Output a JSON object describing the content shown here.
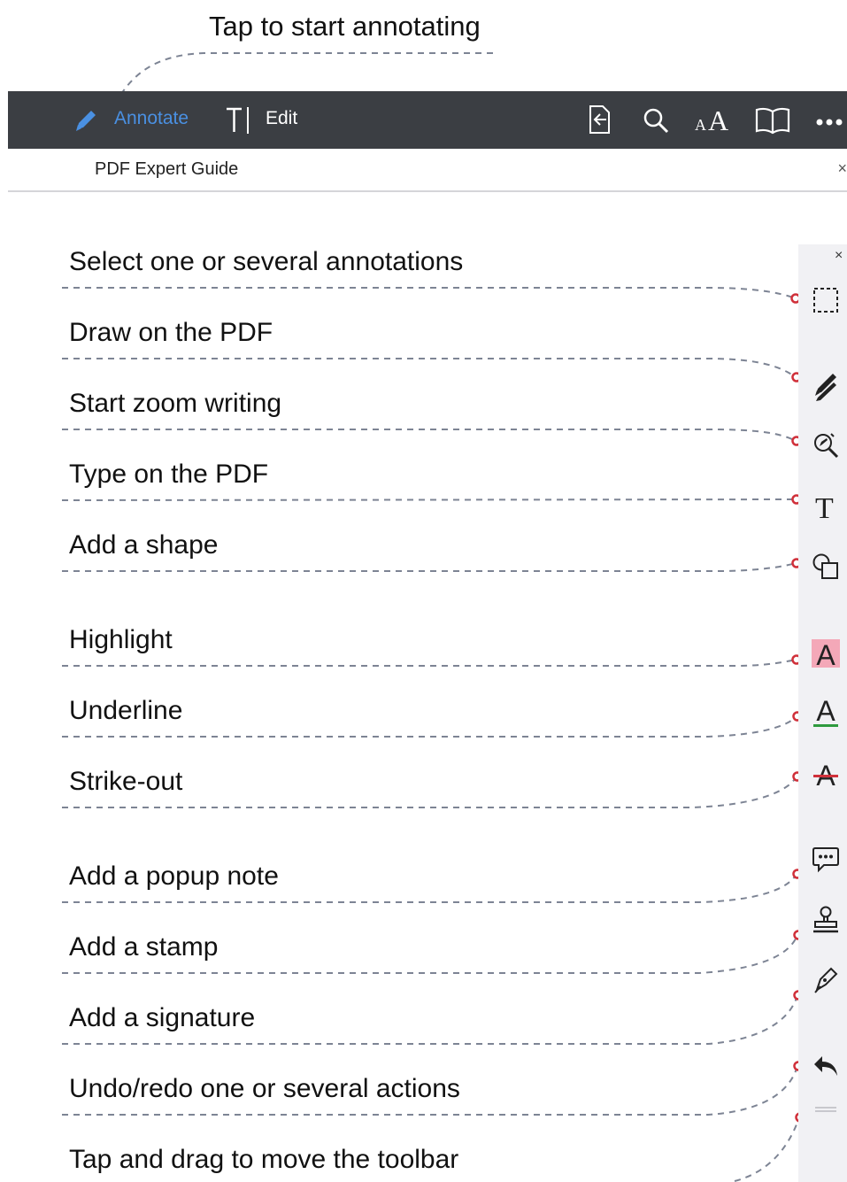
{
  "top_hint": "Tap to start annotating",
  "toolbar": {
    "annotate_label": "Annotate",
    "edit_label": "Edit",
    "icons": [
      "pencil-icon",
      "text-cursor-icon",
      "export-icon",
      "search-icon",
      "font-size-icon",
      "book-icon",
      "more-icon"
    ]
  },
  "document": {
    "title": "PDF Expert Guide",
    "close_glyph": "×"
  },
  "annotation_toolbar": {
    "close_glyph": "×",
    "items": [
      {
        "label": "Select one or several annotations",
        "icon": "selection-icon"
      },
      {
        "label": "Draw on the PDF",
        "icon": "pen-icon"
      },
      {
        "label": "Start zoom writing",
        "icon": "zoom-writing-icon"
      },
      {
        "label": "Type on the PDF",
        "icon": "text-icon"
      },
      {
        "label": "Add a shape",
        "icon": "shape-icon"
      },
      {
        "label": "Highlight",
        "icon": "highlight-icon"
      },
      {
        "label": "Underline",
        "icon": "underline-icon"
      },
      {
        "label": "Strike-out",
        "icon": "strikeout-icon"
      },
      {
        "label": "Add a popup note",
        "icon": "popup-note-icon"
      },
      {
        "label": "Add a stamp",
        "icon": "stamp-icon"
      },
      {
        "label": "Add a signature",
        "icon": "signature-icon"
      },
      {
        "label": "Undo/redo one or several actions",
        "icon": "undo-icon"
      },
      {
        "label": "Tap and drag to move the toolbar",
        "icon": "drag-handle-icon"
      }
    ]
  },
  "colors": {
    "navbar": "#3b3e43",
    "accent": "#4a90e2",
    "guide_line": "#7d8494",
    "anchor": "#d0303a",
    "highlight": "#f4a8b8",
    "underline": "#2e9a3e",
    "strike": "#d0303a"
  }
}
